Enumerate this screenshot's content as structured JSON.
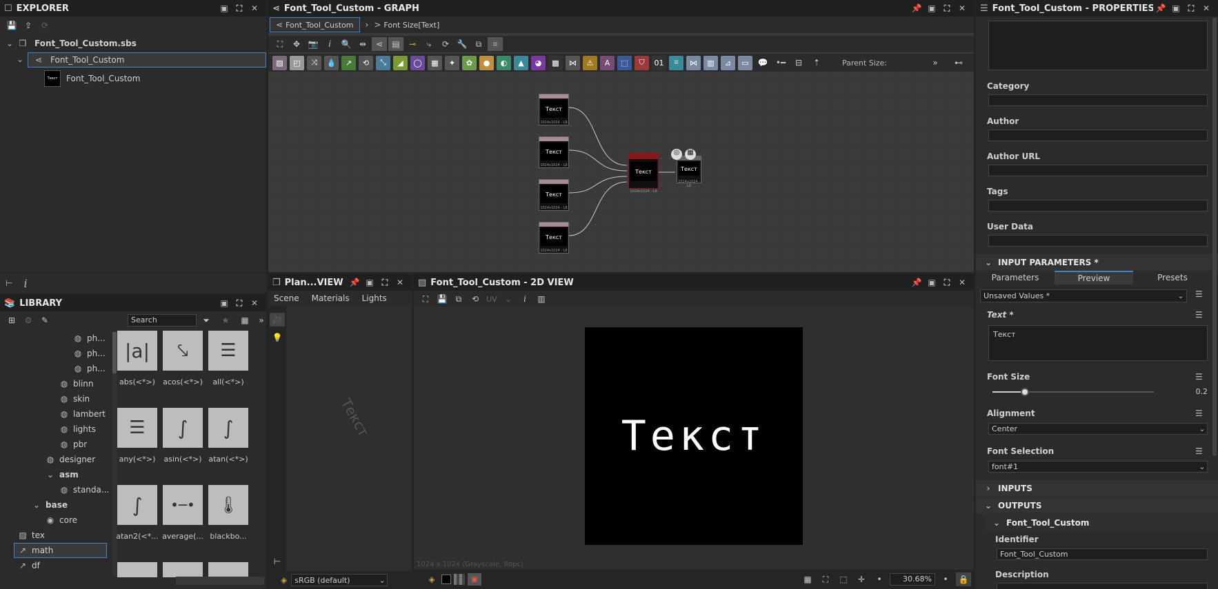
{
  "explorer": {
    "title": "EXPLORER",
    "items": [
      {
        "label": "Font_Tool_Custom.sbs"
      },
      {
        "label": "Font_Tool_Custom"
      },
      {
        "label": "Font_Tool_Custom"
      }
    ]
  },
  "library": {
    "title": "LIBRARY",
    "search_placeholder": "Search",
    "tree": [
      "ph...",
      "ph...",
      "ph...",
      "blinn",
      "skin",
      "lambert",
      "lights",
      "pbr",
      "designer",
      "asm",
      "standa...",
      "base",
      "core",
      "tex",
      "math",
      "df"
    ],
    "tiles": [
      "abs(<*>)",
      "acos(<*>)",
      "all(<*>)",
      "any(<*>)",
      "asin(<*>)",
      "atan(<*>)",
      "atan2(<*...",
      "average(...",
      "blackbo..."
    ]
  },
  "graph": {
    "title": "Font_Tool_Custom - GRAPH",
    "tab_active": "Font_Tool_Custom",
    "breadcrumb": "Font Size[Text]",
    "parent_size_label": "Parent Size:",
    "nodes": [
      {
        "text": "Текст",
        "res": "1024x1024 - L8"
      },
      {
        "text": "Текст",
        "res": "1024x1024 - L8"
      },
      {
        "text": "Текст",
        "res": "1024x1024 - L8"
      },
      {
        "text": "Текст",
        "res": "1024x1024 - L8"
      },
      {
        "text": "Текст",
        "res": "1024x1024 - L8"
      },
      {
        "text": "Текст",
        "res": "1024x1024 - L8"
      }
    ]
  },
  "view3d": {
    "title": "Plan...VIEW",
    "tabs": [
      "Scene",
      "Materials",
      "Lights"
    ],
    "watermark": "Текст",
    "colorspace": "sRGB (default)"
  },
  "view2d": {
    "title": "Font_Tool_Custom - 2D VIEW",
    "uv_label": "UV",
    "preview_text": "Текст",
    "status": "1024 x 1024 (Grayscale, 8bpc)",
    "zoom": "30.68%"
  },
  "properties": {
    "title": "Font_Tool_Custom - PROPERTIES",
    "labels": {
      "category": "Category",
      "author": "Author",
      "author_url": "Author URL",
      "tags": "Tags",
      "user_data": "User Data"
    },
    "input_params_title": "INPUT PARAMETERS *",
    "tabs": [
      "Parameters",
      "Preview",
      "Presets"
    ],
    "preset_value": "Unsaved Values *",
    "text_label": "Text *",
    "text_value": "Текст",
    "font_size_label": "Font Size",
    "font_size_value": "0.2",
    "font_size_fraction": 0.2,
    "alignment_label": "Alignment",
    "alignment_value": "Center",
    "font_selection_label": "Font Selection",
    "font_selection_value": "font#1",
    "inputs_title": "INPUTS",
    "outputs_title": "OUTPUTS",
    "output_name": "Font_Tool_Custom",
    "identifier_label": "Identifier",
    "identifier_value": "Font_Tool_Custom",
    "description_label": "Description"
  },
  "colors": {
    "accent": "#3a86c8",
    "node_header_red": "#8a1a1a"
  }
}
